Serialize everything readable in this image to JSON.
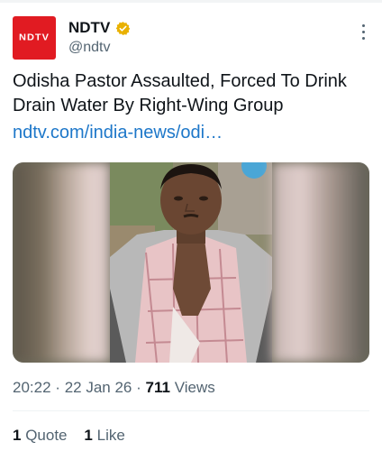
{
  "author": {
    "avatar_text": "NDTV",
    "name": "NDTV",
    "handle": "@ndtv",
    "verified": true,
    "brand_color": "#e11b22",
    "verified_color": "#e9b100"
  },
  "tweet": {
    "text": "Odisha Pastor Assaulted, Forced To Drink Drain Water By Right-Wing Group",
    "link": "ndtv.com/india-news/odi…",
    "link_color": "#1d77c9"
  },
  "media": {
    "description_icon": "photo"
  },
  "meta": {
    "time": "20:22",
    "separator": "·",
    "date": "22 Jan 26",
    "views_count": "711",
    "views_label": "Views"
  },
  "stats": {
    "quotes_count": "1",
    "quotes_label": "Quote",
    "likes_count": "1",
    "likes_label": "Like"
  }
}
